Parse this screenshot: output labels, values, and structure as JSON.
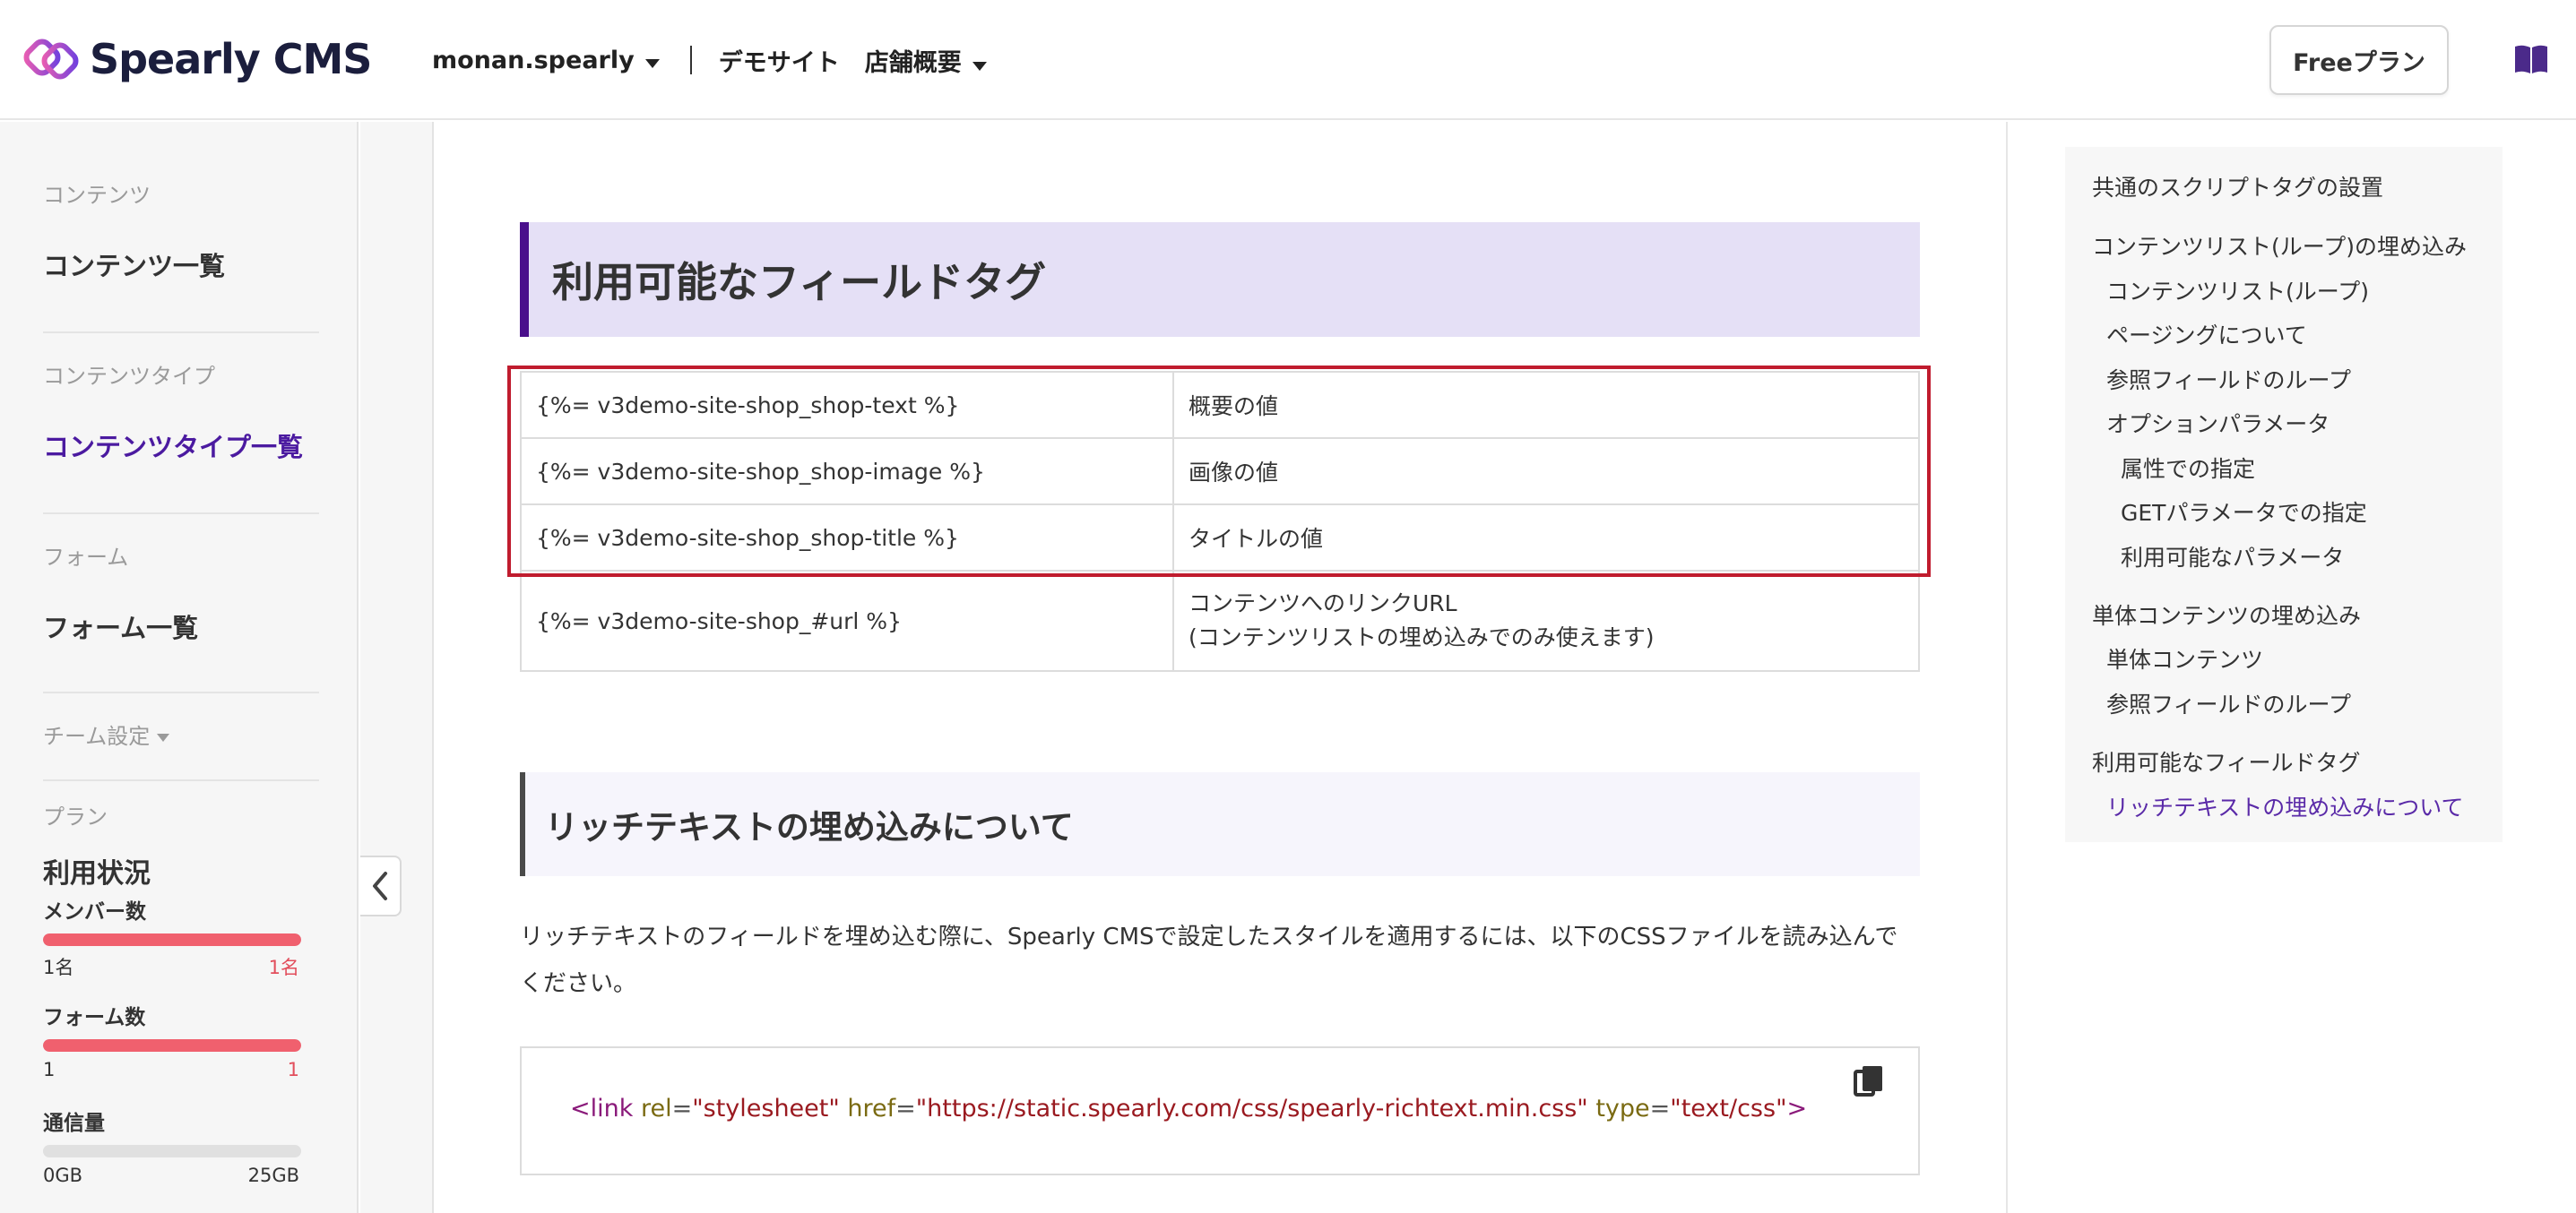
{
  "header": {
    "logo_text": "Spearly CMS",
    "team": "monan.spearly",
    "site": "デモサイト",
    "page": "店舗概要",
    "plan_button": "Freeプラン"
  },
  "sidebar": {
    "section_contents": "コンテンツ",
    "link_contents_list": "コンテンツ一覧",
    "section_content_types": "コンテンツタイプ",
    "link_content_types_list": "コンテンツタイプ一覧",
    "section_forms": "フォーム",
    "link_forms_list": "フォーム一覧",
    "team_settings": "チーム設定",
    "section_plan": "プラン",
    "usage_title": "利用状況",
    "usage": [
      {
        "label": "メンバー数",
        "min": "1名",
        "max": "1名",
        "fill_percent": 100
      },
      {
        "label": "フォーム数",
        "min": "1",
        "max": "1",
        "fill_percent": 100
      },
      {
        "label": "通信量",
        "min": "0GB",
        "max": "25GB",
        "fill_percent": 0
      }
    ]
  },
  "main": {
    "h2_fields": "利用可能なフィールドタグ",
    "field_rows": [
      {
        "tag": "{%= v3demo-site-shop_shop-text %}",
        "desc": "概要の値"
      },
      {
        "tag": "{%= v3demo-site-shop_shop-image %}",
        "desc": "画像の値"
      },
      {
        "tag": "{%= v3demo-site-shop_shop-title %}",
        "desc": "タイトルの値"
      },
      {
        "tag": "{%= v3demo-site-shop_#url %}",
        "desc_line1": "コンテンツへのリンクURL",
        "desc_line2": "(コンテンツリストの埋め込みでのみ使えます)"
      }
    ],
    "h3_rich": "リッチテキストの埋め込みについて",
    "para": "リッチテキストのフィールドを埋め込む際に、Spearly CMSで設定したスタイルを適用するには、以下のCSSファイルを読み込んでください。",
    "code": {
      "open": "<link",
      "attr_rel": "rel",
      "val_rel": "\"stylesheet\"",
      "attr_href": "href",
      "val_href": "\"https://static.spearly.com/css/spearly-richtext.min.css\"",
      "attr_type": "type",
      "val_type": "\"text/css\"",
      "close": ">",
      "eq": "="
    }
  },
  "toc": {
    "items": [
      "共通のスクリプトタグの設置",
      "コンテンツリスト(ループ)の埋め込み",
      "コンテンツリスト(ループ)",
      "ページングについて",
      "参照フィールドのループ",
      "オプションパラメータ",
      "属性での指定",
      "GETパラメータでの指定",
      "利用可能なパラメータ",
      "単体コンテンツの埋め込み",
      "単体コンテンツ",
      "参照フィールドのループ",
      "利用可能なフィールドタグ",
      "リッチテキストの埋め込みについて"
    ]
  },
  "colors": {
    "accent_purple": "#4a0f8c",
    "active_link": "#4b1aa0",
    "usage_bar": "#f0606e",
    "highlight_red": "#c01c2e"
  },
  "icons": {
    "logo": "spearly-logo-icon",
    "book": "book-icon",
    "collapse": "chevron-left-icon",
    "copy": "copy-icon"
  }
}
